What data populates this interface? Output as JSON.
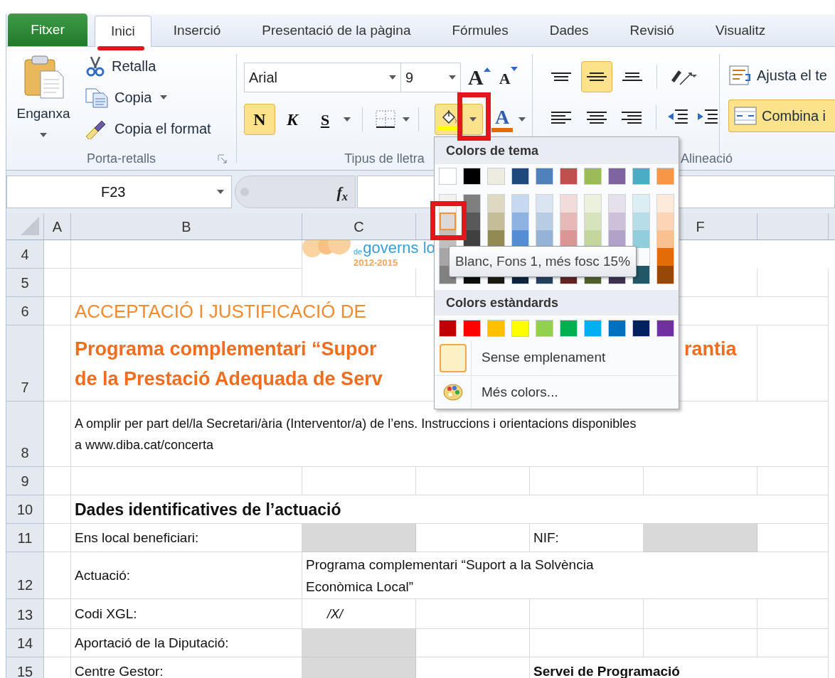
{
  "tabs": [
    {
      "label": "Fitxer",
      "kind": "file",
      "selected": false
    },
    {
      "label": "Inici",
      "kind": "tab",
      "selected": true
    },
    {
      "label": "Inserció",
      "kind": "tab",
      "selected": false
    },
    {
      "label": "Presentació de la pàgina",
      "kind": "tab",
      "selected": false
    },
    {
      "label": "Fórmules",
      "kind": "tab",
      "selected": false
    },
    {
      "label": "Dades",
      "kind": "tab",
      "selected": false
    },
    {
      "label": "Revisió",
      "kind": "tab",
      "selected": false
    },
    {
      "label": "Visualitz",
      "kind": "tab",
      "selected": false
    }
  ],
  "ribbon": {
    "clipboard": {
      "paste": "Enganxa",
      "cut": "Retalla",
      "copy": "Copia",
      "format_painter": "Copia el format",
      "group_label": "Porta-retalls"
    },
    "font": {
      "font_name": "Arial",
      "font_size": "9",
      "grow": "A",
      "shrink": "A",
      "styles": [
        {
          "kind": "bold",
          "label": "N",
          "selected": true
        },
        {
          "kind": "italic",
          "label": "K",
          "selected": false
        },
        {
          "kind": "underline",
          "label": "S",
          "selected": false
        }
      ],
      "fill_color": {
        "selected": true,
        "color": "#ffff00"
      },
      "font_color": {
        "label": "A",
        "color": "#e36c09"
      },
      "group_label": "Tipus de lletra"
    },
    "alignment": {
      "vertical": [
        {
          "kind": "top",
          "selected": false
        },
        {
          "kind": "middle",
          "selected": true
        },
        {
          "kind": "bottom",
          "selected": false
        }
      ],
      "horizontal": [
        {
          "kind": "left",
          "selected": false
        },
        {
          "kind": "center",
          "selected": false
        },
        {
          "kind": "right",
          "selected": false
        }
      ],
      "group_label": "Alineació"
    },
    "wrap_text": "Ajusta el te",
    "merge": {
      "label": "Combina i",
      "selected": true
    }
  },
  "formula_bar": {
    "name_box": "F23",
    "function_label": "f$_{x}$"
  },
  "sheet": {
    "columns": [
      {
        "label": "A"
      },
      {
        "label": "B"
      },
      {
        "label": "C"
      },
      {},
      {},
      {
        "label": "F"
      },
      {}
    ],
    "rows": [
      {
        "number": "4",
        "cells": [
          "",
          "",
          {
            "kind": "logo",
            "prefix": "de",
            "name": "governs lo",
            "years": "2012-2015"
          }
        ]
      },
      {
        "number": "5",
        "cells": []
      },
      {
        "number": "6",
        "cells": [
          "",
          {
            "kind": "title",
            "lines": [
              "ACCEPTACIÓ I JUSTIFICACIÓ DE"
            ]
          }
        ]
      },
      {
        "number": "7",
        "cells": [
          "",
          {
            "kind": "subtitle",
            "lines": [
              "Programa complementari “Supor",
              "de la Prestació Adequada de Serv"
            ]
          },
          "",
          "",
          "",
          {
            "kind": "continuation",
            "lines": [
              "rantia"
            ]
          }
        ]
      },
      {
        "number": "8",
        "cells": [
          "",
          {
            "kind": "note",
            "lines": [
              "A omplir per part del/la Secretari/ària (Interventor/a) de l’ens. Instruccions i orientacions disponibles",
              "a www.diba.cat/concerta"
            ]
          }
        ]
      },
      {
        "number": "9",
        "cells": []
      },
      {
        "number": "10",
        "cells": [
          "",
          {
            "kind": "heading",
            "lines": [
              "Dades identificatives de l’actuació"
            ]
          }
        ]
      },
      {
        "number": "11",
        "cells": [
          "",
          {
            "kind": "label",
            "lines": [
              "Ens local beneficiari:"
            ]
          },
          {
            "kind": "filled"
          },
          "",
          {
            "kind": "label",
            "lines": [
              "NIF:"
            ]
          },
          {
            "kind": "filled"
          }
        ]
      },
      {
        "number": "12",
        "cells": [
          "",
          {
            "kind": "label",
            "lines": [
              "Actuació:"
            ]
          },
          {
            "kind": "body",
            "lines": [
              "Programa complementari “Suport a la Solvència",
              "Econòmica Local”"
            ]
          }
        ]
      },
      {
        "number": "13",
        "cells": [
          "",
          {
            "kind": "label",
            "lines": [
              "Codi XGL:"
            ]
          },
          {
            "kind": "code",
            "lines": [
              "/X/"
            ]
          }
        ]
      },
      {
        "number": "14",
        "cells": [
          "",
          {
            "kind": "label",
            "lines": [
              "Aportació de la Diputació:"
            ]
          },
          {
            "kind": "filled"
          }
        ]
      },
      {
        "number": "15",
        "cells": [
          "",
          {
            "kind": "label",
            "lines": [
              "Centre Gestor:"
            ]
          },
          {
            "kind": "filled"
          },
          "",
          {
            "kind": "strong",
            "lines": [
              "Servei de Programació"
            ]
          }
        ]
      }
    ]
  },
  "fill_menu": {
    "theme_title": "Colors de tema",
    "theme": [
      {
        "color": "#ffffff",
        "selected": false,
        "shades": [
          {
            "color": "#f2f2f2",
            "selected": false
          },
          {
            "color": "#d9d9d9",
            "selected": true
          },
          {
            "color": "#bfbfbf",
            "selected": false
          },
          {
            "color": "#a6a6a6",
            "selected": false
          },
          {
            "color": "#808080",
            "selected": false
          }
        ]
      },
      {
        "color": "#000000",
        "selected": false,
        "shades": [
          {
            "color": "#7f7f7f",
            "selected": false
          },
          {
            "color": "#595959",
            "selected": false
          },
          {
            "color": "#404040",
            "selected": false
          },
          {
            "color": "#0d0d0d",
            "selected": false
          }
        ]
      },
      {
        "color": "#eeece1",
        "selected": false,
        "shades": [
          {
            "color": "#ddd9c3",
            "selected": false
          },
          {
            "color": "#c4bd97",
            "selected": false
          },
          {
            "color": "#938953",
            "selected": false
          },
          {
            "color": "#1d1b10",
            "selected": false
          }
        ]
      },
      {
        "color": "#1f497d",
        "selected": false,
        "shades": [
          {
            "color": "#c6d9f0",
            "selected": false
          },
          {
            "color": "#8db3e2",
            "selected": false
          },
          {
            "color": "#548dd4",
            "selected": false
          },
          {
            "color": "#0f243e",
            "selected": false
          }
        ]
      },
      {
        "color": "#4f81bd",
        "selected": false,
        "shades": [
          {
            "color": "#dbe5f1",
            "selected": false
          },
          {
            "color": "#b8cce4",
            "selected": false
          },
          {
            "color": "#95b3d7",
            "selected": false
          },
          {
            "color": "#244061",
            "selected": false
          }
        ]
      },
      {
        "color": "#c0504d",
        "selected": false,
        "shades": [
          {
            "color": "#f2dcdb",
            "selected": false
          },
          {
            "color": "#e5b9b7",
            "selected": false
          },
          {
            "color": "#d99694",
            "selected": false
          },
          {
            "color": "#632423",
            "selected": false
          }
        ]
      },
      {
        "color": "#9bbb59",
        "selected": false,
        "shades": [
          {
            "color": "#ebf1dd",
            "selected": false
          },
          {
            "color": "#d7e3bc",
            "selected": false
          },
          {
            "color": "#c3d69b",
            "selected": false
          },
          {
            "color": "#4f6128",
            "selected": false
          }
        ]
      },
      {
        "color": "#8064a2",
        "selected": false,
        "shades": [
          {
            "color": "#e5e0ec",
            "selected": false
          },
          {
            "color": "#ccc1d9",
            "selected": false
          },
          {
            "color": "#b2a2c7",
            "selected": false
          },
          {
            "color": "#3f3151",
            "selected": false
          }
        ]
      },
      {
        "color": "#4bacc6",
        "selected": false,
        "shades": [
          {
            "color": "#dbeef3",
            "selected": false
          },
          {
            "color": "#b7dde8",
            "selected": false
          },
          {
            "color": "#92cddc",
            "selected": false
          },
          {
            "color": "#205867",
            "selected": false
          }
        ]
      },
      {
        "color": "#f79646",
        "selected": false,
        "shades": [
          {
            "color": "#fdeada",
            "selected": false
          },
          {
            "color": "#fbd5b5",
            "selected": false
          },
          {
            "color": "#fac08f",
            "selected": false
          },
          {
            "color": "#e36c09",
            "selected": false
          },
          {
            "color": "#974806",
            "selected": false
          }
        ]
      }
    ],
    "tooltip": "Blanc, Fons 1, més fosc 15%",
    "standard_title": "Colors estàndards",
    "standard": [
      {
        "color": "#c00000",
        "selected": false
      },
      {
        "color": "#ff0000",
        "selected": false
      },
      {
        "color": "#ffc000",
        "selected": false
      },
      {
        "color": "#ffff00",
        "selected": false
      },
      {
        "color": "#92d050",
        "selected": false
      },
      {
        "color": "#00b050",
        "selected": false
      },
      {
        "color": "#00b0f0",
        "selected": false
      },
      {
        "color": "#0070c0",
        "selected": false
      },
      {
        "color": "#002060",
        "selected": false
      },
      {
        "color": "#7030a0",
        "selected": false
      }
    ],
    "no_fill": "Sense emplenament",
    "more_colors": "Més colors..."
  }
}
